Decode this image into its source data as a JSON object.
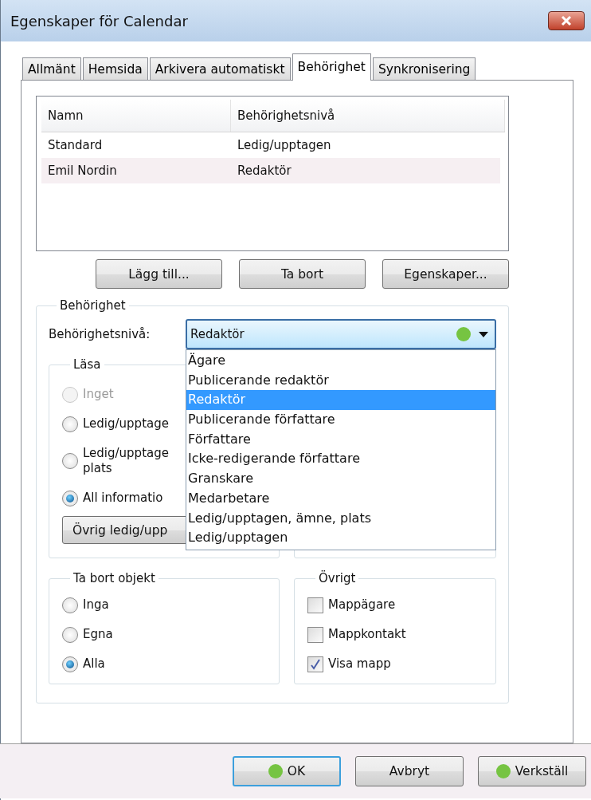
{
  "window": {
    "title": "Egenskaper för Calendar"
  },
  "tabs": [
    {
      "label": "Allmänt",
      "selected": false
    },
    {
      "label": "Hemsida",
      "selected": false
    },
    {
      "label": "Arkivera automatiskt",
      "selected": false
    },
    {
      "label": "Behörighet",
      "selected": true
    },
    {
      "label": "Synkronisering",
      "selected": false
    }
  ],
  "permissions_table": {
    "columns": [
      "Namn",
      "Behörighetsnivå"
    ],
    "rows": [
      {
        "cells": [
          "Standard",
          "Ledig/upptagen"
        ],
        "selected": false
      },
      {
        "cells": [
          "Emil Nordin",
          "Redaktör"
        ],
        "selected": true
      }
    ]
  },
  "list_buttons": [
    "Lägg till...",
    "Ta bort",
    "Egenskaper..."
  ],
  "permission_group": {
    "title": "Behörighet",
    "level_label": "Behörighetsnivå:",
    "level_value": "Redaktör",
    "level_marked": true,
    "dropdown_options": [
      {
        "label": "Ägare",
        "selected": false
      },
      {
        "label": "Publicerande redaktör",
        "selected": false
      },
      {
        "label": "Redaktör",
        "selected": true
      },
      {
        "label": "Publicerande författare",
        "selected": false
      },
      {
        "label": "Författare",
        "selected": false
      },
      {
        "label": "Icke-redigerande författare",
        "selected": false
      },
      {
        "label": "Granskare",
        "selected": false
      },
      {
        "label": "Medarbetare",
        "selected": false
      },
      {
        "label": "Ledig/upptagen, ämne, plats",
        "selected": false
      },
      {
        "label": "Ledig/upptagen",
        "selected": false
      }
    ]
  },
  "read_group": {
    "title": "Läsa",
    "options": [
      {
        "label": "Inget",
        "selected": false,
        "disabled": true
      },
      {
        "label": "Ledig/upptage",
        "selected": false,
        "disabled": false
      },
      {
        "label": "Ledig/upptage plats",
        "selected": false,
        "disabled": false
      },
      {
        "label": "All informatio",
        "selected": true,
        "disabled": false
      }
    ],
    "button": "Övrig ledig/upp"
  },
  "delete_group": {
    "title": "Ta bort objekt",
    "options": [
      {
        "label": "Inga",
        "selected": false
      },
      {
        "label": "Egna",
        "selected": false
      },
      {
        "label": "Alla",
        "selected": true
      }
    ]
  },
  "other_group": {
    "title": "Övrigt",
    "options": [
      {
        "label": "Mappägare",
        "checked": false
      },
      {
        "label": "Mappkontakt",
        "checked": false
      },
      {
        "label": "Visa mapp",
        "checked": true
      }
    ]
  },
  "footer_buttons": [
    {
      "label": "OK",
      "default": true,
      "marked": true
    },
    {
      "label": "Avbryt",
      "default": false,
      "marked": false
    },
    {
      "label": "Verkställ",
      "default": false,
      "marked": true
    }
  ]
}
